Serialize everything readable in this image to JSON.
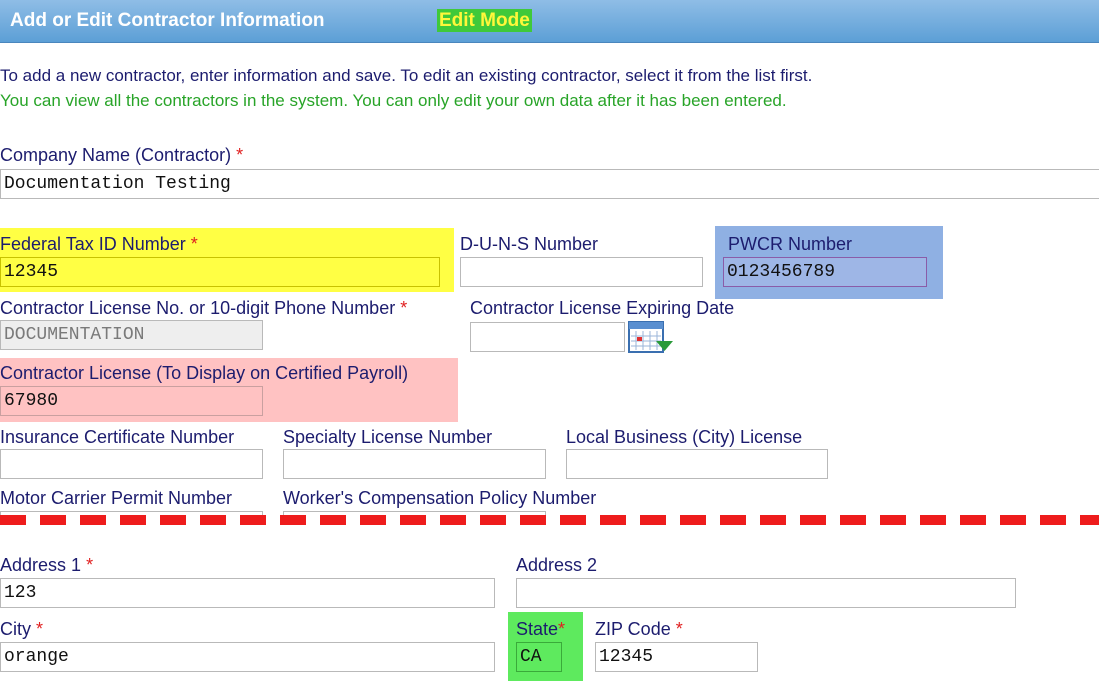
{
  "header": {
    "title": "Add or Edit Contractor Information",
    "mode_badge": "Edit Mode"
  },
  "instructions": {
    "line1": "To add a new contractor, enter information and save. To edit an existing contractor, select it from the list first.",
    "line2": "You can view all the contractors in the system. You can only edit your own data after it has been entered."
  },
  "form": {
    "company_name": {
      "label": "Company Name (Contractor)",
      "value": "Documentation Testing"
    },
    "federal_tax_id": {
      "label": "Federal Tax ID Number",
      "value": "12345"
    },
    "duns": {
      "label": "D-U-N-S Number",
      "value": ""
    },
    "pwcr": {
      "label": "PWCR Number",
      "value": "0123456789"
    },
    "contractor_license_no": {
      "label": "Contractor License No. or 10-digit Phone Number",
      "value": "DOCUMENTATION"
    },
    "license_expiring": {
      "label": "Contractor License Expiring Date",
      "value": ""
    },
    "license_display": {
      "label": "Contractor License (To Display on Certified Payroll)",
      "value": "67980"
    },
    "insurance_cert": {
      "label": "Insurance Certificate Number",
      "value": ""
    },
    "specialty_license": {
      "label": "Specialty License Number",
      "value": ""
    },
    "local_business_license": {
      "label": "Local Business (City) License",
      "value": ""
    },
    "motor_carrier": {
      "label": "Motor Carrier Permit Number",
      "value": ""
    },
    "workers_comp": {
      "label": "Worker's Compensation Policy Number",
      "value": ""
    },
    "address1": {
      "label": "Address 1",
      "value": "123"
    },
    "address2": {
      "label": "Address 2",
      "value": ""
    },
    "city": {
      "label": "City",
      "value": "orange"
    },
    "state": {
      "label": "State",
      "value": "CA"
    },
    "zip": {
      "label": "ZIP Code",
      "value": "12345"
    },
    "required_marker": "*"
  },
  "icons": {
    "calendar": "calendar-icon"
  },
  "colors": {
    "header": "#6aa7db",
    "edit_badge_bg": "#3fc93a",
    "edit_badge_text": "#fff73a",
    "highlight_yellow": "#ffff44",
    "highlight_blue": "#8fb0e3",
    "highlight_pink": "#ffc2c2",
    "highlight_green": "#5eea5e",
    "required": "#e02020",
    "dashed_line": "#ee1c1c"
  }
}
